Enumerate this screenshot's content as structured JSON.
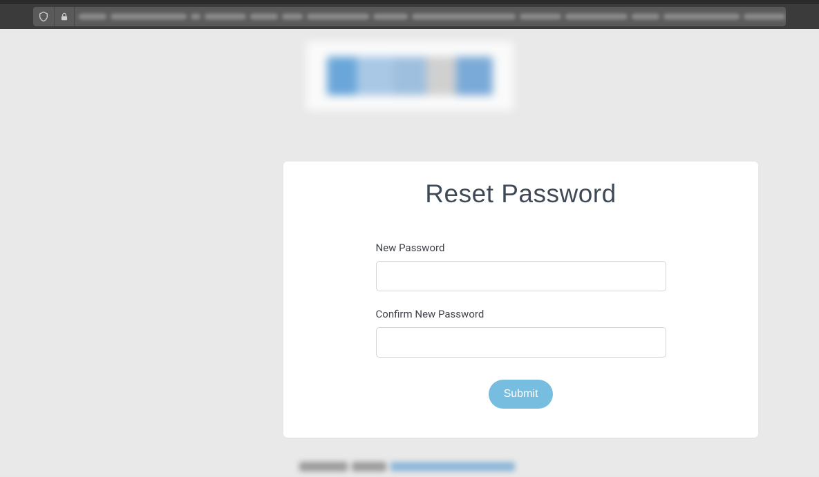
{
  "card": {
    "title": "Reset Password",
    "new_password_label": "New Password",
    "new_password_value": "",
    "confirm_password_label": "Confirm New Password",
    "confirm_password_value": "",
    "submit_label": "Submit"
  },
  "colors": {
    "accent": "#77bde0",
    "card_bg": "#ffffff",
    "page_bg": "#e9e9e9",
    "text_dark": "#3f4a56"
  }
}
